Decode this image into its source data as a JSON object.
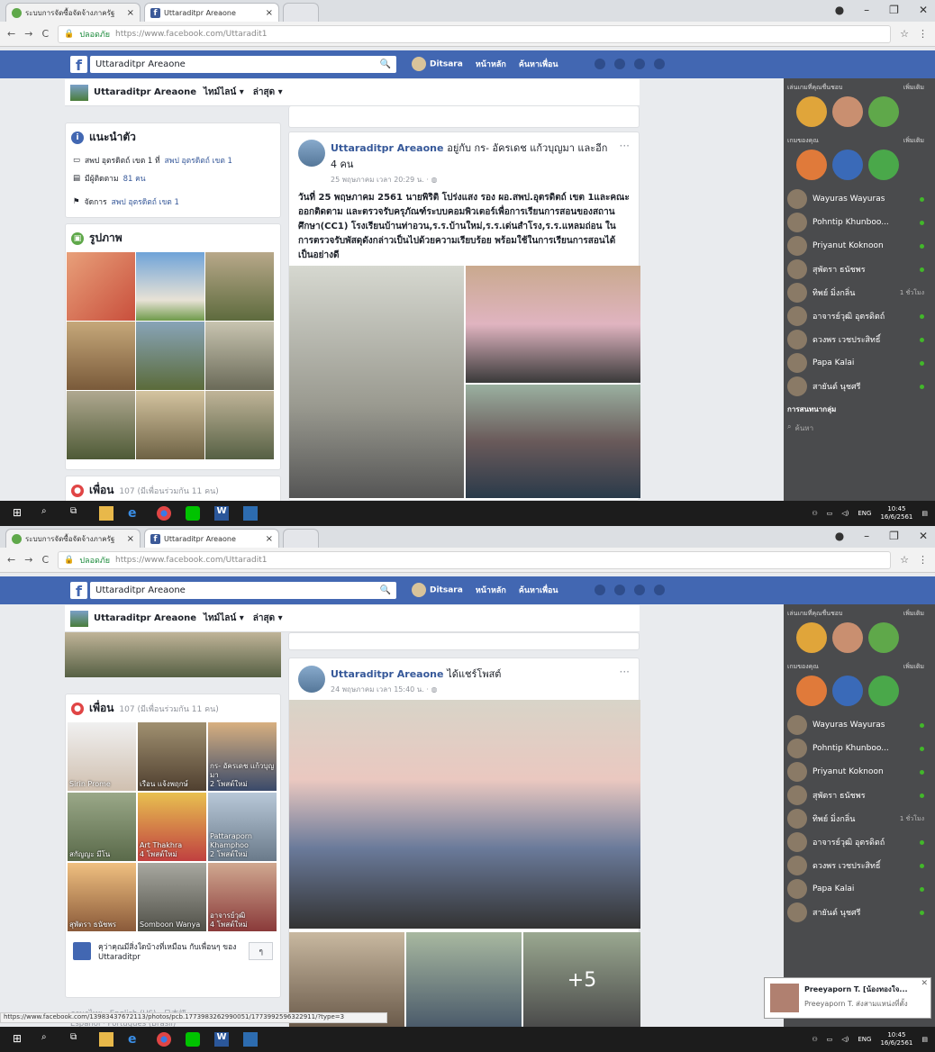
{
  "browser": {
    "tab1_label": "ระบบการจัดซื้อจัดจ้างภาครัฐ",
    "tab2_label": "Uttaraditpr Areaone",
    "secure_label": "ปลอดภัย",
    "url_prefix": "https://www.facebook.com/",
    "url_path": "Uttaradit1",
    "status_url": "https://www.facebook.com/13983437672113/photos/pcb.1773983262990051/1773992596322911/?type=3"
  },
  "fb": {
    "search_value": "Uttaraditpr Areaone",
    "user_name": "Ditsara",
    "nav_home": "หน้าหลัก",
    "nav_find_friends": "ค้นหาเพื่อน"
  },
  "page": {
    "name": "Uttaraditpr Areaone",
    "timeline_label": "ไทม์ไลน์",
    "recent_label": "ล่าสุด"
  },
  "about": {
    "title": "แนะนำตัว",
    "line1_pre": "สพป อุตรดิตถ์ เขต 1 ที่",
    "line1_link": "สพป อุตรดิตถ์ เขต 1",
    "line2_pre": "มีผู้ติดตาม",
    "line2_link": "81 คน",
    "line3_pre": "จัดการ",
    "line3_link": "สพป อุตรดิตถ์ เขต 1"
  },
  "photos": {
    "title": "รูปภาพ"
  },
  "friends": {
    "title": "เพื่อน",
    "count": "107 (มีเพื่อนร่วมกัน 11 คน)",
    "items": [
      {
        "name": "Sirin Prome"
      },
      {
        "name": "เรือน แจ้งพฤกษ์"
      },
      {
        "name": "กร- อัครเดช แก้วบุญมา\n2 โพสต์ใหม่"
      },
      {
        "name": "สกัญญะ มีโน"
      },
      {
        "name": "Art Thakhra\n4 โพสต์ใหม่"
      },
      {
        "name": "Pattaraporn Khamphoo\n2 โพสต์ใหม่"
      },
      {
        "name": "สุพัตรา ธนัชพร"
      },
      {
        "name": "Somboon Wanya"
      },
      {
        "name": "อาจารย์วุฒิ\n4 โพสต์ใหม่"
      }
    ],
    "suggest_text": "คุว่าคุณมีสิ่งใดบ้างที่เหมือน กับเพื่อนๆ ของ Uttaraditpr",
    "languages": "ภาษาไทย · English (US) · 日本語",
    "languages2": "Español · Português (Brasil)"
  },
  "post1": {
    "author": "Uttaraditpr Areaone",
    "with_text": "อยู่กับ กร- อัครเดช แก้วบุญมา และอีก 4 คน",
    "time": "25 พฤษภาคม เวลา 20:29 น. ·",
    "body": "วันที่ 25 พฤษภาคม 2561 นายพิริติ โปร่งแสง รอง ผอ.สพป.อุตรดิตถ์ เขต 1และคณะ ออกติดตาม และตรวจรับครุภัณฑ์ระบบคอมพิวเตอร์เพื่อการเรียนการสอนของสถานศึกษา(CC1) โรงเรียนบ้านท่าอวน,ร.ร.บ้านใหม่,ร.ร.เด่นสำโรง,ร.ร.แหลมถ่อน ในการตรวจรับพัสดุดังกล่าวเป็นไปด้วยความเรียบร้อย พร้อมใช้ในการเรียนการสอนได้เป็นอย่างดี"
  },
  "post2": {
    "author": "Uttaraditpr Areaone",
    "with_text": "ได้แชร์โพสต์",
    "time": "24 พฤษภาคม เวลา 15:40 น. ·",
    "more_photos": "+5"
  },
  "sidebar": {
    "sec1": "เล่นเกมที่คุณชื่นชอบ",
    "sec1_more": "เพิ่มเติม",
    "sec2": "เกมของคุณ",
    "sec2_more": "เพิ่มเติม",
    "contacts": [
      {
        "name": "Wayuras Wayuras",
        "status": ""
      },
      {
        "name": "Pohntip Khunboo...",
        "status": ""
      },
      {
        "name": "Priyanut Koknoon",
        "status": ""
      },
      {
        "name": "สุพัตรา ธนัชพร",
        "status": ""
      },
      {
        "name": "ทิพย์ มิ่งกลิ่น",
        "status": "1 ชั่วโมง"
      },
      {
        "name": "อาจารย์วุฒิ อุตรดิตถ์",
        "status": ""
      },
      {
        "name": "ดวงพร เวชประสิทธิ์",
        "status": ""
      },
      {
        "name": "Papa Kalai",
        "status": ""
      },
      {
        "name": "สายันต์ นุชศรี",
        "status": ""
      }
    ],
    "group_chat": "การสนทนากลุ่ม",
    "search_placeholder": "ค้นหา"
  },
  "notification": {
    "title": "Preeyaporn T. [น้องทองใจ...",
    "body": "Preeyaporn T. ส่งสามแหน่งที่ตั้ง"
  },
  "taskbar": {
    "lang": "ENG",
    "time": "10:45",
    "date": "16/6/2561"
  },
  "colors": {
    "fb_blue": "#4267b2",
    "link_blue": "#365899",
    "online_green": "#42b72a"
  }
}
